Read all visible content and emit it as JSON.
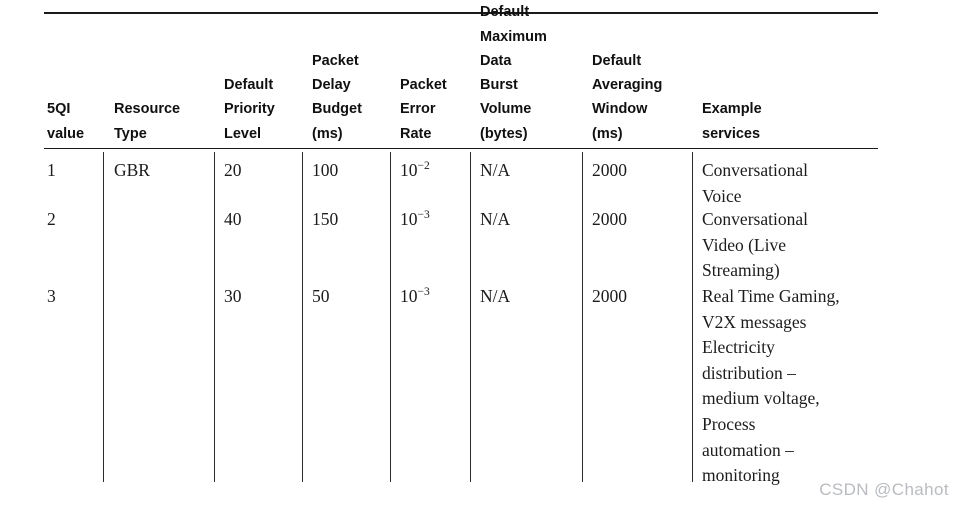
{
  "table": {
    "columns": [
      {
        "id": "5qi-value",
        "header": "5QI\nvalue"
      },
      {
        "id": "resource-type",
        "header": "Resource\nType"
      },
      {
        "id": "default-priority-level",
        "header": "Default\nPriority\nLevel"
      },
      {
        "id": "packet-delay-budget",
        "header": "Packet\nDelay\nBudget\n(ms)"
      },
      {
        "id": "packet-error-rate",
        "header": "Packet\nError\nRate"
      },
      {
        "id": "default-max-data-burst-volume",
        "header": "Default\nMaximum\nData Burst\nVolume\n(bytes)"
      },
      {
        "id": "default-averaging-window",
        "header": "Default\nAveraging\nWindow\n(ms)"
      },
      {
        "id": "example-services",
        "header": "Example services"
      }
    ],
    "rows": [
      {
        "qi_value": "1",
        "resource_type": "GBR",
        "default_priority_level": "20",
        "packet_delay_budget": "100",
        "packet_error_rate_base": "10",
        "packet_error_rate_exponent": "−2",
        "default_max_data_burst_volume": "N/A",
        "default_averaging_window": "2000",
        "example_services": "Conversational\nVoice"
      },
      {
        "qi_value": "2",
        "resource_type": "",
        "default_priority_level": "40",
        "packet_delay_budget": "150",
        "packet_error_rate_base": "10",
        "packet_error_rate_exponent": "−3",
        "default_max_data_burst_volume": "N/A",
        "default_averaging_window": "2000",
        "example_services": "Conversational\nVideo (Live\nStreaming)"
      },
      {
        "qi_value": "3",
        "resource_type": "",
        "default_priority_level": "30",
        "packet_delay_budget": "50",
        "packet_error_rate_base": "10",
        "packet_error_rate_exponent": "−3",
        "default_max_data_burst_volume": "N/A",
        "default_averaging_window": "2000",
        "example_services": "Real Time Gaming,\nV2X messages\nElectricity\ndistribution –\nmedium voltage,\nProcess\nautomation –\nmonitoring"
      }
    ]
  },
  "watermark": {
    "text": "CSDN @Chahot"
  },
  "colors": {
    "rule": "#1a1a1a",
    "divider": "#2b2b2b",
    "header_text": "#101010",
    "body_text": "#1c1c1c",
    "watermark_text": "#b9bcc0",
    "background": "#ffffff"
  }
}
